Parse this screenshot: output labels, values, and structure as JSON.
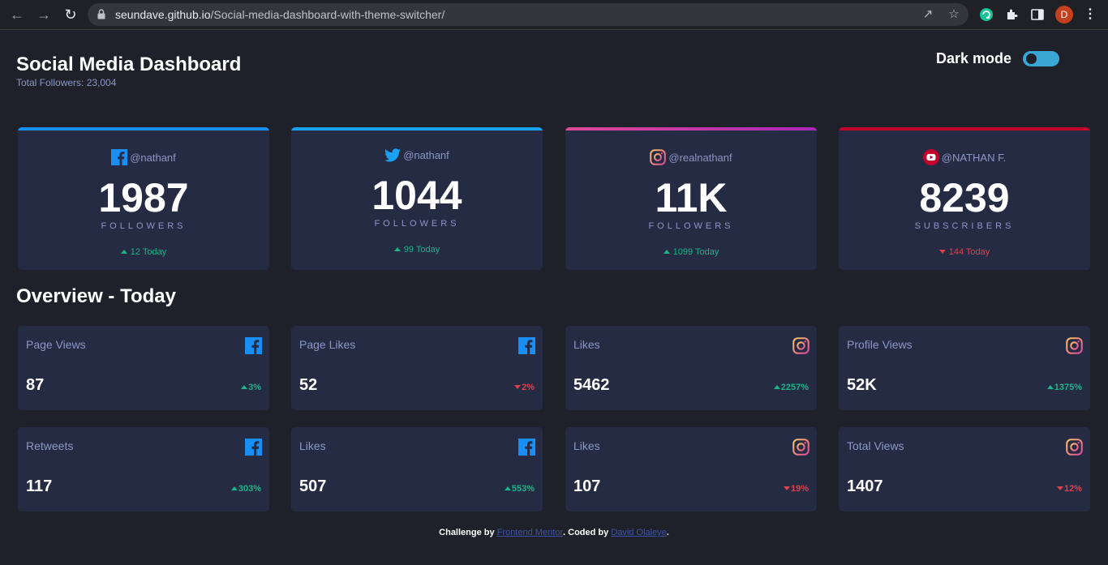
{
  "browser": {
    "url_host": "seundave.github.io",
    "url_path": "/Social-media-dashboard-with-theme-switcher/",
    "avatar_letter": "D"
  },
  "header": {
    "title": "Social Media Dashboard",
    "total_followers": "Total Followers: 23,004",
    "dark_mode_label": "Dark mode",
    "dark_mode_on": true
  },
  "colors": {
    "facebook": "#198ff5",
    "twitter": "#1ca0f2",
    "instagram_start": "#fdc468",
    "instagram_end": "#df4996",
    "youtube": "#c4032a",
    "up": "#1db489",
    "down": "#dc414c"
  },
  "followers": [
    {
      "icon": "facebook-icon",
      "handle": "@nathanf",
      "count": "1987",
      "unit": "FOLLOWERS",
      "delta": "12 Today",
      "trend": "up"
    },
    {
      "icon": "twitter-icon",
      "handle": "@nathanf",
      "count": "1044",
      "unit": "FOLLOWERS",
      "delta": "99 Today",
      "trend": "up"
    },
    {
      "icon": "instagram-icon",
      "handle": "@realnathanf",
      "count": "11K",
      "unit": "FOLLOWERS",
      "delta": "1099 Today",
      "trend": "up"
    },
    {
      "icon": "youtube-icon",
      "handle": "@NATHAN F.",
      "count": "8239",
      "unit": "SUBSCRIBERS",
      "delta": "144 Today",
      "trend": "down"
    }
  ],
  "overview": {
    "title": "Overview - Today",
    "cards": [
      {
        "label": "Page Views",
        "icon": "facebook-icon",
        "value": "87",
        "pct": "3%",
        "trend": "up"
      },
      {
        "label": "Page Likes",
        "icon": "facebook-icon",
        "value": "52",
        "pct": "2%",
        "trend": "down"
      },
      {
        "label": "Likes",
        "icon": "instagram-icon",
        "value": "5462",
        "pct": "2257%",
        "trend": "up"
      },
      {
        "label": "Profile Views",
        "icon": "instagram-icon",
        "value": "52K",
        "pct": "1375%",
        "trend": "up"
      },
      {
        "label": "Retweets",
        "icon": "facebook-icon",
        "value": "117",
        "pct": "303%",
        "trend": "up"
      },
      {
        "label": "Likes",
        "icon": "facebook-icon",
        "value": "507",
        "pct": "553%",
        "trend": "up"
      },
      {
        "label": "Likes",
        "icon": "instagram-icon",
        "value": "107",
        "pct": "19%",
        "trend": "down"
      },
      {
        "label": "Total Views",
        "icon": "instagram-icon",
        "value": "1407",
        "pct": "12%",
        "trend": "down"
      }
    ]
  },
  "footer": {
    "prefix": "Challenge by ",
    "link1": "Frontend Mentor",
    "middle": ". Coded by ",
    "link2": "David Olaleye",
    "suffix": "."
  }
}
